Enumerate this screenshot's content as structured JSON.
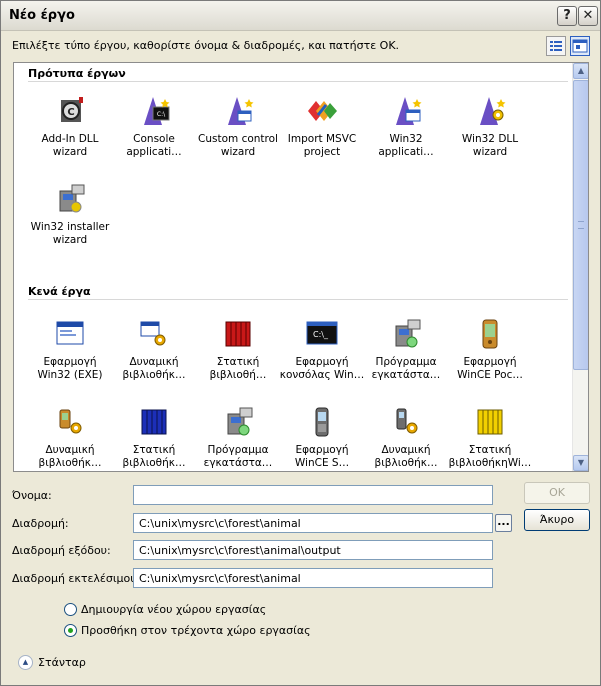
{
  "window": {
    "title": "Νέο έργο",
    "help_label": "?",
    "close_label": "✕"
  },
  "instruction": "Επιλέξτε τύπο έργου, καθορίστε όνομα & διαδρομές, και πατήστε ΟΚ.",
  "view_buttons": [
    "list-view-icon",
    "large-icons-view-icon"
  ],
  "templates": {
    "heading": "Πρότυπα έργων",
    "items": [
      {
        "label": "Add-In DLL wizard",
        "icon": "addin-wizard-icon"
      },
      {
        "label": "Console applicati…",
        "icon": "wizard-icon"
      },
      {
        "label": "Custom control wizard",
        "icon": "wizard-icon"
      },
      {
        "label": "Import MSVC project",
        "icon": "import-msvc-icon"
      },
      {
        "label": "Win32 applicati…",
        "icon": "wizard-icon"
      },
      {
        "label": "Win32 DLL wizard",
        "icon": "wizard-icon"
      },
      {
        "label": "Win32 installer wizard",
        "icon": "installer-wizard-icon"
      }
    ]
  },
  "empty": {
    "heading": "Κενά έργα",
    "items": [
      {
        "label": "Εφαρμογή Win32 (EXE)",
        "icon": "window-app-icon"
      },
      {
        "label": "Δυναμική βιβλιοθήκ…",
        "icon": "dll-icon"
      },
      {
        "label": "Στατική βιβλιοθή…",
        "icon": "static-lib-icon"
      },
      {
        "label": "Εφαρμογή κονσόλας Win…",
        "icon": "console-icon"
      },
      {
        "label": "Πρόγραμμα εγκατάστα…",
        "icon": "installer-icon"
      },
      {
        "label": "Εφαρμογή WinCE Poc…",
        "icon": "pocketpc-icon"
      },
      {
        "label": "Δυναμική βιβλιοθήκ…",
        "icon": "ce-dll-icon"
      },
      {
        "label": "Στατική βιβλιοθήκ…",
        "icon": "static-lib-blue-icon"
      },
      {
        "label": "Πρόγραμμα εγκατάστα…",
        "icon": "installer-icon"
      },
      {
        "label": "Εφαρμογή WinCE S…",
        "icon": "smartphone-icon"
      },
      {
        "label": "Δυναμική βιβλιοθήκ…",
        "icon": "phone-dll-icon"
      },
      {
        "label": "Στατική βιβλιοθήκηWi…",
        "icon": "static-lib-yellow-icon"
      }
    ]
  },
  "form": {
    "name_label": "Όνομα:",
    "name_value": "",
    "path_label": "Διαδρομή:",
    "path_value": "C:\\unix\\mysrc\\c\\forest\\animal",
    "browse_label": "...",
    "output_label": "Διαδρομή εξόδου:",
    "output_value": "C:\\unix\\mysrc\\c\\forest\\animal\\output",
    "exec_label": "Διαδρομή εκτελέσιμου:",
    "exec_value": "C:\\unix\\mysrc\\c\\forest\\animal"
  },
  "buttons": {
    "ok": "OK",
    "cancel": "Άκυρο"
  },
  "workspace": {
    "options": [
      {
        "label": "Δημιουργία νέου χώρου εργασίας",
        "checked": false
      },
      {
        "label": "Προσθήκη στον τρέχοντα χώρο εργασίας",
        "checked": true
      }
    ]
  },
  "standard_label": "Στάνταρ",
  "colors": {
    "accent": "#2d5fbf",
    "titlebar": "#e8e6dc",
    "panel": "#ffffff",
    "selected_radio": "#21a121"
  }
}
